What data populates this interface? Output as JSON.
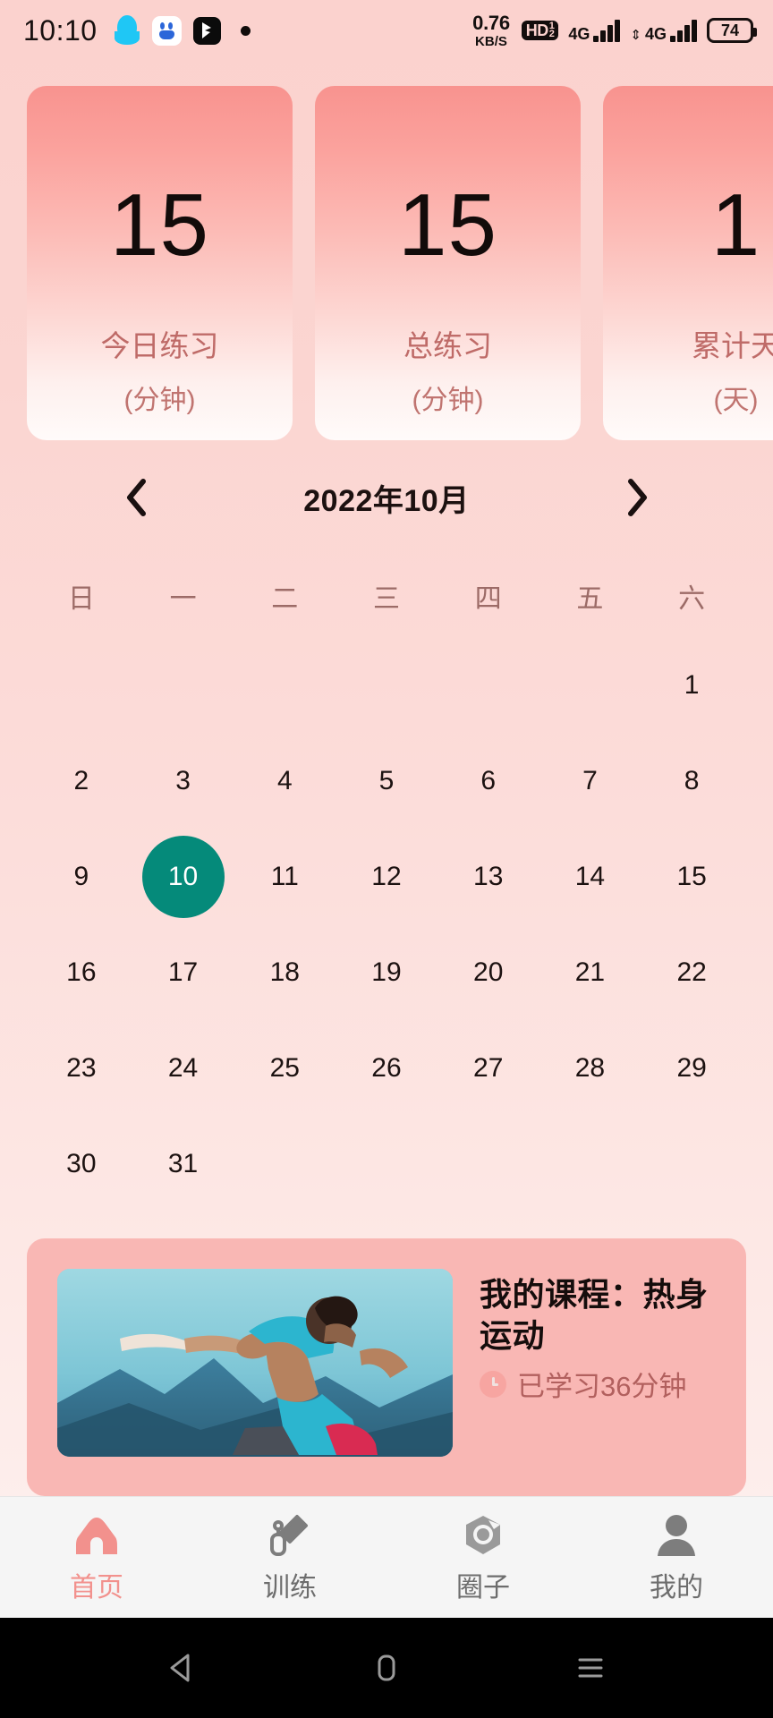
{
  "statusbar": {
    "time": "10:10",
    "icons": [
      "qq-icon",
      "baidu-icon",
      "app-icon",
      "dot-icon"
    ],
    "network_speed_value": "0.76",
    "network_speed_unit": "KB/S",
    "hd_label": "HD",
    "hd_sup": "1",
    "hd_sub": "2",
    "sim1_label": "4G",
    "sim2_label": "4G",
    "battery": "74"
  },
  "stats": {
    "cards": [
      {
        "value": "15",
        "label": "今日练习",
        "unit": "(分钟)"
      },
      {
        "value": "15",
        "label": "总练习",
        "unit": "(分钟)"
      },
      {
        "value": "1",
        "label": "累计天",
        "unit": "(天)"
      }
    ]
  },
  "calendar": {
    "title": "2022年10月",
    "prev_label": "上个月",
    "next_label": "下个月",
    "weekdays": [
      "日",
      "一",
      "二",
      "三",
      "四",
      "五",
      "六"
    ],
    "weeks": [
      [
        "",
        "",
        "",
        "",
        "",
        "",
        "1"
      ],
      [
        "2",
        "3",
        "4",
        "5",
        "6",
        "7",
        "8"
      ],
      [
        "9",
        "10",
        "11",
        "12",
        "13",
        "14",
        "15"
      ],
      [
        "16",
        "17",
        "18",
        "19",
        "20",
        "21",
        "22"
      ],
      [
        "23",
        "24",
        "25",
        "26",
        "27",
        "28",
        "29"
      ],
      [
        "30",
        "31",
        "",
        "",
        "",
        "",
        ""
      ]
    ],
    "selected_day": "10",
    "selected_color": "#058a7a"
  },
  "course": {
    "title": "我的课程：热身运动",
    "progress_text": "已学习36分钟",
    "thumb_alt": "runner-photo"
  },
  "tabbar": {
    "items": [
      {
        "label": "首页",
        "icon": "home-icon",
        "active": true
      },
      {
        "label": "训练",
        "icon": "dumbbell-icon",
        "active": false
      },
      {
        "label": "圈子",
        "icon": "community-icon",
        "active": false
      },
      {
        "label": "我的",
        "icon": "person-icon",
        "active": false
      }
    ],
    "active_color": "#f2918d",
    "inactive_color": "#6d6d6d"
  },
  "androidnav": {
    "back": "back-button",
    "home": "home-button",
    "recents": "recents-button"
  },
  "theme": {
    "bg_top": "#fbd2ce",
    "bg_bottom": "#fdf2f0",
    "card_accent": "#f8938f",
    "text_rose": "#bf6b68"
  }
}
